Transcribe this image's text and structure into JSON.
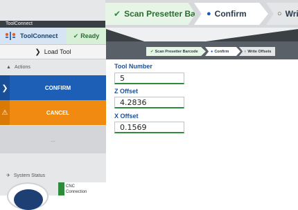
{
  "wizard": {
    "steps": [
      {
        "label": "Scan Presetter Barcode",
        "icon": "checkmark-icon",
        "state": "done"
      },
      {
        "label": "Confirm",
        "icon": "filled-circle-icon",
        "state": "active"
      },
      {
        "label": "Write Offsets",
        "icon": "hollow-circle-icon",
        "state": "pending"
      }
    ]
  },
  "sidebar": {
    "window_title": "ToolConnect",
    "brand": "ToolConnect",
    "status": "Ready",
    "load_tool": "Load Tool",
    "actions_heading": "Actions",
    "confirm_label": "CONFIRM",
    "cancel_label": "CANCEL",
    "empty_slot": "...",
    "system_status_heading": "System Status",
    "cnc_line1": "CNC",
    "cnc_line2": "Connection"
  },
  "form": {
    "tool_number_label": "Tool Number",
    "tool_number_value": "5",
    "z_offset_label": "Z Offset",
    "z_offset_value": "4.2836",
    "x_offset_label": "X Offset",
    "x_offset_value": "0.1569"
  },
  "colors": {
    "primary": "#1d5fb6",
    "warning": "#f08a10",
    "success": "#2e8b3a"
  }
}
